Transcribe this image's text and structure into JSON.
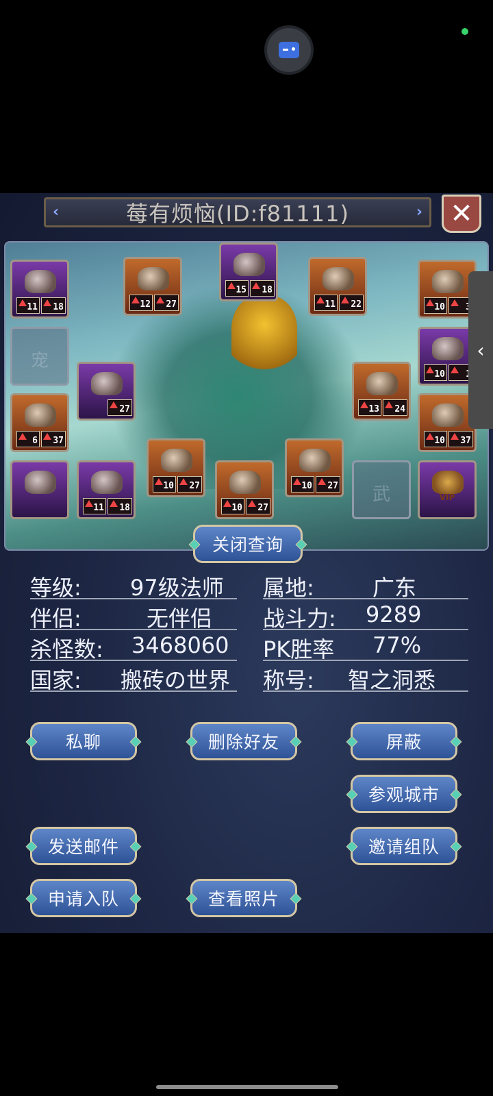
{
  "overlay": {
    "game_button_icon": "gamepad-icon",
    "status_dot_color": "#38d36a"
  },
  "header": {
    "title": "莓有烦恼(ID:f81111)",
    "close_icon": "close-x-icon"
  },
  "equipment": {
    "slots": [
      {
        "id": "slot-1",
        "lv1": "11",
        "lv2": "18"
      },
      {
        "id": "slot-2",
        "lv1": "12",
        "lv2": "27"
      },
      {
        "id": "slot-3",
        "lv1": "15",
        "lv2": "18"
      },
      {
        "id": "slot-4",
        "lv1": "11",
        "lv2": "22"
      },
      {
        "id": "slot-5",
        "lv1": "10",
        "lv2": "3"
      },
      {
        "id": "slot-pet",
        "glyph": "宠"
      },
      {
        "id": "slot-7",
        "lv1": "10",
        "lv2": "1"
      },
      {
        "id": "slot-8",
        "lv2": "27"
      },
      {
        "id": "slot-9",
        "lv1": "13",
        "lv2": "24"
      },
      {
        "id": "slot-10",
        "lv1": "6",
        "lv2": "37"
      },
      {
        "id": "slot-11",
        "lv1": "10",
        "lv2": "37"
      },
      {
        "id": "slot-12",
        "lv1": "10",
        "lv2": "27"
      },
      {
        "id": "slot-13",
        "lv1": "10",
        "lv2": "27"
      },
      {
        "id": "slot-14",
        "lv1": "11",
        "lv2": "18"
      },
      {
        "id": "slot-15",
        "lv1": "10",
        "lv2": "27"
      },
      {
        "id": "slot-weapon",
        "glyph": "武"
      },
      {
        "id": "slot-vip",
        "vip": "VIP"
      }
    ]
  },
  "buttons": {
    "close_query": "关闭查询",
    "private_chat": "私聊",
    "delete_friend": "删除好友",
    "block": "屏蔽",
    "visit_city": "参观城市",
    "send_mail": "发送邮件",
    "invite_team": "邀请组队",
    "apply_join": "申请入队",
    "view_photos": "查看照片"
  },
  "info": {
    "level_label": "等级:",
    "level_value": "97级法师",
    "region_label": "属地:",
    "region_value": "广东",
    "partner_label": "伴侣:",
    "partner_value": "无伴侣",
    "power_label": "战斗力:",
    "power_value": "9289",
    "kills_label": "杀怪数:",
    "kills_value": "3468060",
    "pk_label": "PK胜率",
    "pk_value": "77%",
    "country_label": "国家:",
    "country_value": "搬砖の世界",
    "title_label": "称号:",
    "title_value": "智之洞悉"
  }
}
